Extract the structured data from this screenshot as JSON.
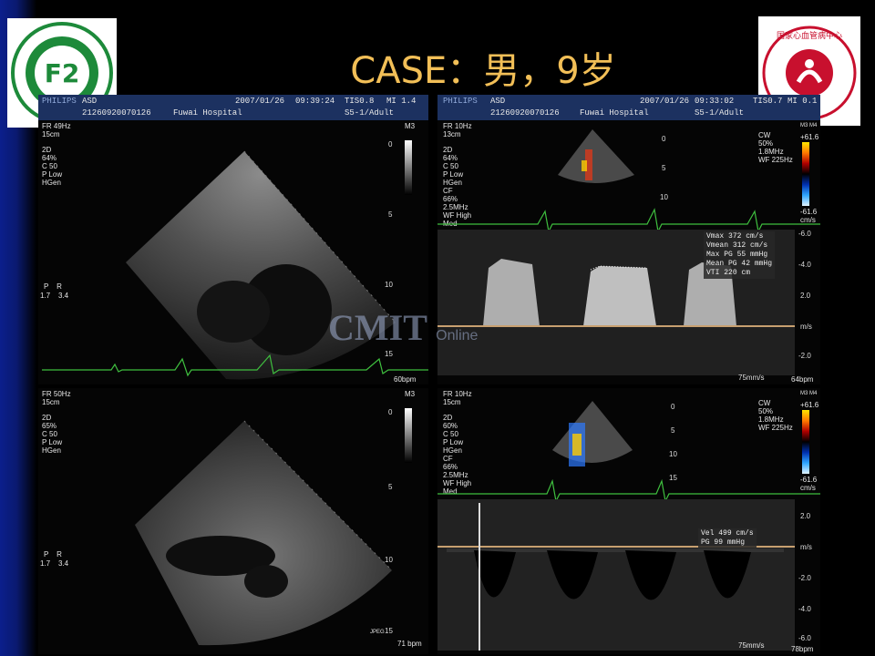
{
  "slide": {
    "title": "CASE：男，9岁",
    "logos": [
      {
        "name": "hospital-seal-left",
        "text": "F2"
      },
      {
        "name": "hospital-seal-right",
        "text": "国家心血管病中心"
      }
    ],
    "watermark": {
      "main": "CMIT",
      "sub": "Online"
    }
  },
  "panels": {
    "top_left": {
      "brand": "PHILIPS",
      "exam": "ASD",
      "patient_id": "21260920070126",
      "hospital": "Fuwai Hospital",
      "date": "2007/01/26",
      "time": "09:39:24",
      "tis": "TIS0.8",
      "mi": "MI 1.4",
      "probe": "S5-1/Adult",
      "fr": "FR 49Hz",
      "depth": "15cm",
      "settings": "2D\n64%\nC 50\nP Low\nHGen",
      "scale_ticks": [
        "0",
        "5",
        "10",
        "15"
      ],
      "bpm": "60bpm",
      "mode": "M3",
      "orient": "P    R",
      "orient_vals": "1.7    3.4"
    },
    "top_right": {
      "brand": "PHILIPS",
      "exam": "ASD",
      "patient_id": "21260920070126",
      "hospital": "Fuwai Hospital",
      "date": "2007/01/26",
      "time": "09:33:02",
      "tis": "TIS0.7",
      "mi": "MI 0.1",
      "probe": "S5-1/Adult",
      "fr": "FR 10Hz",
      "depth": "13cm",
      "settings": "2D\n64%\nC 50\nP Low\nHGen\nCF\n66%\n2.5MHz\nWF High\nMed",
      "cw": "CW\n50%\n1.8MHz\nWF 225Hz",
      "color_max": "+61.6",
      "color_min": "-61.6\ncm/s",
      "mini_ticks": [
        "0",
        "5",
        "10"
      ],
      "vel_ticks": [
        "-6.0",
        "-4.0",
        "2.0",
        "m/s",
        "-2.0"
      ],
      "measurements": [
        {
          "label": "Vmax",
          "value": "372 cm/s"
        },
        {
          "label": "Vmean",
          "value": "312 cm/s"
        },
        {
          "label": "Max PG",
          "value": "55 mmHg"
        },
        {
          "label": "Mean PG",
          "value": "42 mmHg"
        },
        {
          "label": "VTI",
          "value": "220 cm"
        }
      ],
      "sweep": "75mm/s",
      "bpm": "64bpm",
      "mode": "M3 M4"
    },
    "bottom_left": {
      "fr": "FR 50Hz",
      "depth": "15cm",
      "settings": "2D\n65%\nC 50\nP Low\nHGen",
      "scale_ticks": [
        "0",
        "5",
        "10",
        "15"
      ],
      "bpm": "71 bpm",
      "format": "JPEG",
      "mode": "M3",
      "orient": "P    R",
      "orient_vals": "1.7    3.4"
    },
    "bottom_right": {
      "fr": "FR 10Hz",
      "depth": "15cm",
      "settings": "2D\n60%\nC 50\nP Low\nHGen\nCF\n66%\n2.5MHz\nWF High\nMed",
      "cw": "CW\n50%\n1.8MHz\nWF 225Hz",
      "color_max": "+61.6",
      "color_min": "-61.6\ncm/s",
      "mini_ticks": [
        "0",
        "5",
        "10",
        "15"
      ],
      "vel_ticks": [
        "2.0",
        "m/s",
        "-2.0",
        "-4.0",
        "-6.0"
      ],
      "measurements": [
        {
          "label": "Vel",
          "value": "499 cm/s"
        },
        {
          "label": "PG",
          "value": "99 mmHg"
        }
      ],
      "sweep": "75mm/s",
      "bpm": "78bpm",
      "mode": "M3 M4"
    }
  },
  "colors": {
    "title": "#f2bf57",
    "ecg": "#3fbf3f",
    "header_bar": "#1c3160",
    "baseline": "#c8a070"
  }
}
